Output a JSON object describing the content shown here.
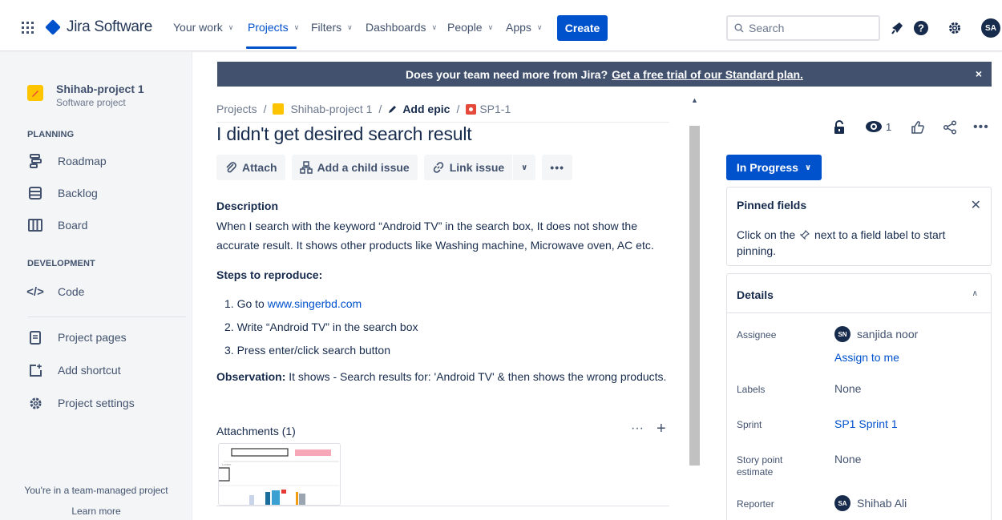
{
  "topnav": {
    "product": "Jira Software",
    "items": [
      {
        "label": "Your work"
      },
      {
        "label": "Projects"
      },
      {
        "label": "Filters"
      },
      {
        "label": "Dashboards"
      },
      {
        "label": "People"
      },
      {
        "label": "Apps"
      }
    ],
    "create_label": "Create",
    "search_placeholder": "Search",
    "avatar_initials": "SA",
    "colors": {
      "brand": "#0052cc",
      "text": "#42526e"
    }
  },
  "sidebar": {
    "project_name": "Shihab-project 1",
    "project_type": "Software project",
    "planning_header": "PLANNING",
    "planning_items": [
      {
        "label": "Roadmap",
        "icon": "roadmap-icon"
      },
      {
        "label": "Backlog",
        "icon": "backlog-icon"
      },
      {
        "label": "Board",
        "icon": "board-icon"
      }
    ],
    "development_header": "DEVELOPMENT",
    "code_label": "Code",
    "other_items": [
      {
        "label": "Project pages",
        "icon": "pages-icon"
      },
      {
        "label": "Add shortcut",
        "icon": "add-shortcut-icon"
      },
      {
        "label": "Project settings",
        "icon": "settings-icon"
      }
    ],
    "team_note": "You're in a team-managed project",
    "learn_more": "Learn more"
  },
  "banner": {
    "text": "Does your team need more from Jira?",
    "link": "Get a free trial of our Standard plan.",
    "close": "×"
  },
  "breadcrumbs": {
    "root": "Projects",
    "project": "Shihab-project 1",
    "epic": "Add epic",
    "issue_key": "SP1-1"
  },
  "issue": {
    "title": "I didn't get desired search result",
    "toolbar": {
      "attach": "Attach",
      "child": "Add a child issue",
      "link": "Link issue",
      "more": "•••"
    },
    "description_label": "Description",
    "description": "When I search with the keyword “Android TV” in the search box, It does not show the accurate result. It shows other products like Washing machine, Microwave oven, AC etc.",
    "steps_label": "Steps to reproduce:",
    "steps": {
      "s1_prefix": "1. Go to ",
      "s1_link": "www.singerbd.com",
      "s2": "2. Write “Android TV” in the search box",
      "s3": "3. Press enter/click search button"
    },
    "observation_label": "Observation:",
    "observation": " It shows - Search results for: 'Android TV' & then shows the wrong products.",
    "attachments_label": "Attachments (1)",
    "attach_more": "···",
    "attach_add": "+"
  },
  "panel": {
    "watch_count": "1",
    "status": "In Progress",
    "pinned_title": "Pinned fields",
    "pinned_text_a": "Click on the",
    "pinned_text_b": "next to a field label to start pinning.",
    "details_title": "Details",
    "fields": {
      "assignee_label": "Assignee",
      "assignee": "sanjida noor",
      "assignee_initials": "SN",
      "assign_to_me": "Assign to me",
      "labels_label": "Labels",
      "labels": "None",
      "sprint_label": "Sprint",
      "sprint": "SP1 Sprint 1",
      "story_label": "Story point estimate",
      "story": "None",
      "reporter_label": "Reporter",
      "reporter": "Shihab Ali",
      "reporter_initials": "SA"
    }
  }
}
